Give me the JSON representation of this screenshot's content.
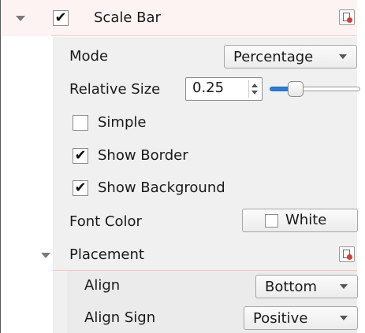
{
  "scale_bar": {
    "label": "Scale Bar",
    "checked": "✔",
    "mode_label": "Mode",
    "mode_value": "Percentage",
    "relative_size_label": "Relative Size",
    "relative_size_value": "0.25",
    "relative_size_slider": 0.25,
    "simple_label": "Simple",
    "show_border_label": "Show Border",
    "show_border_check": "✔",
    "show_background_label": "Show Background",
    "show_background_check": "✔",
    "font_color_label": "Font Color",
    "font_color_value": "White",
    "font_color_hex": "#ffffff"
  },
  "placement": {
    "label": "Placement",
    "align_label": "Align",
    "align_value": "Bottom",
    "align_sign_label": "Align Sign",
    "align_sign_value": "Positive"
  },
  "icons": {
    "expand": "chevron-down-icon",
    "reset": "reset-default-icon",
    "dropdown": "dropdown-arrow-icon",
    "spin": "spin-arrows-icon"
  },
  "colors": {
    "accent": "#2a7fd4",
    "header_bg": "#fdf3f3",
    "reset_dot": "#d83a3a"
  }
}
